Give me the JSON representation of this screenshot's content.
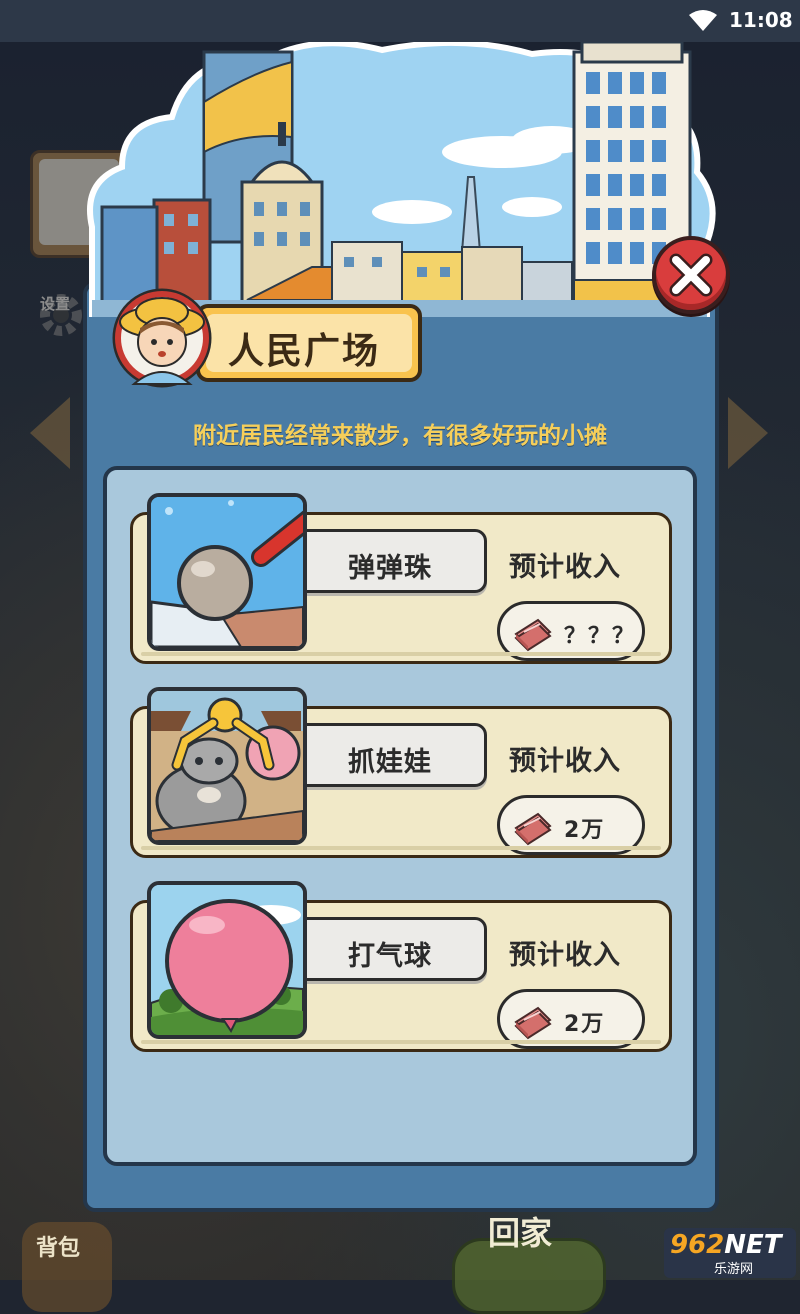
{
  "status_bar": {
    "time": "11:08"
  },
  "background": {
    "settings_label": "设置",
    "backpack_label": "背包",
    "home_label": "回家"
  },
  "watermark": {
    "brand": "962",
    "brand_suffix": "NET",
    "sub": "乐游网"
  },
  "dialog": {
    "title": "人民广场",
    "subtitle": "附近居民经常来散步，有很多好玩的小摊",
    "stalls": [
      {
        "name": "弹弹珠",
        "income_label": "预计收入",
        "income_value": "？？？"
      },
      {
        "name": "抓娃娃",
        "income_label": "预计收入",
        "income_value": "2万"
      },
      {
        "name": "打气球",
        "income_label": "预计收入",
        "income_value": "2万"
      }
    ]
  },
  "colors": {
    "dialog_blue": "#4a7ba4",
    "panel_blue": "#a9c8dc",
    "card_cream": "#f1e9c8",
    "title_gold": "#f9c34e",
    "subtitle_yellow": "#f6cf5a",
    "close_red": "#d93d3d"
  },
  "icons": [
    "wifi-icon",
    "close-icon",
    "money-icon",
    "settings-gear-icon"
  ]
}
